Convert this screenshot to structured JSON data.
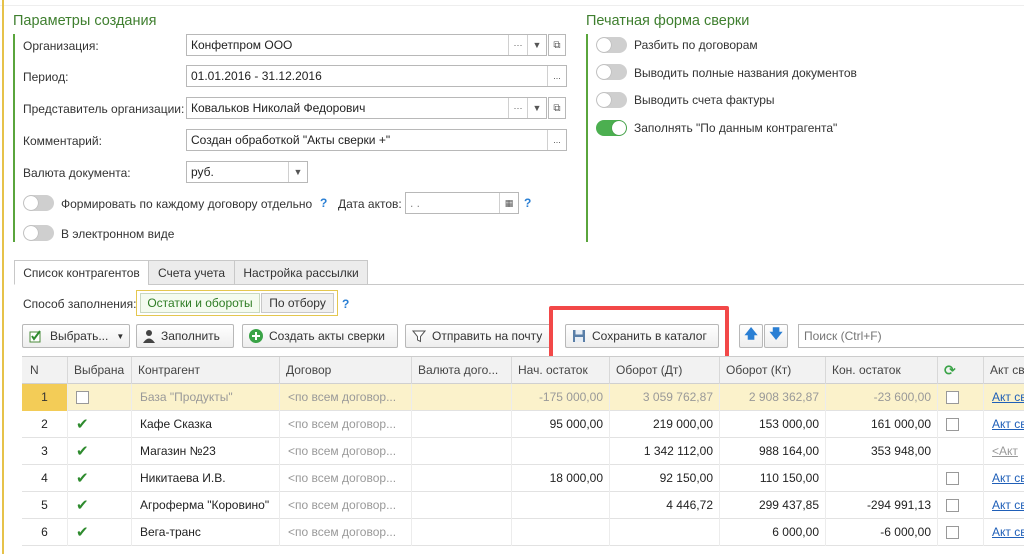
{
  "params": {
    "title": "Параметры создания",
    "org_label": "Организация:",
    "org_value": "Конфетпром ООО",
    "period_label": "Период:",
    "period_value": "01.01.2016 - 31.12.2016",
    "rep_label": "Представитель организации:",
    "rep_value": "Ковальков Николай Федорович",
    "comment_label": "Комментарий:",
    "comment_value": "Создан обработкой \"Акты сверки +\"",
    "currency_label": "Валюта документа:",
    "currency_value": "руб.",
    "per_contract_label": "Формировать по каждому договору отдельно",
    "act_date_label": "Дата актов:",
    "act_date_value": " .  .",
    "electronic_label": "В электронном виде"
  },
  "print": {
    "title": "Печатная форма сверки",
    "opt1": "Разбить по договорам",
    "opt2": "Выводить полные названия документов",
    "opt3": "Выводить счета фактуры",
    "opt4": "Заполнять \"По данным контрагента\""
  },
  "tabs": [
    "Список контрагентов",
    "Счета учета",
    "Настройка рассылки"
  ],
  "fill": {
    "label": "Способ заполнения:",
    "opt_a": "Остатки и обороты",
    "opt_b": "По отбору"
  },
  "toolbar": {
    "select": "Выбрать...",
    "fill": "Заполнить",
    "create": "Создать акты сверки",
    "send": "Отправить на почту",
    "save": "Сохранить в каталог",
    "search_placeholder": "Поиск (Ctrl+F)"
  },
  "grid": {
    "headers": [
      "N",
      "Выбрана",
      "Контрагент",
      "Договор",
      "Валюта дого...",
      "Нач. остаток",
      "Оборот (Дт)",
      "Оборот (Кт)",
      "Кон. остаток",
      "",
      "Акт св"
    ],
    "rows": [
      {
        "n": "1",
        "checked": false,
        "name": "База \"Продукты\"",
        "contract": "<по всем договор...",
        "start": "-175 000,00",
        "dt": "3 059 762,87",
        "kt": "2 908 362,87",
        "end": "-23 600,00",
        "flag": "box",
        "act": "Акт св"
      },
      {
        "n": "2",
        "checked": true,
        "name": "Кафе Сказка",
        "contract": "<по всем договор...",
        "start": "95 000,00",
        "dt": "219 000,00",
        "kt": "153 000,00",
        "end": "161 000,00",
        "flag": "box",
        "act": "Акт св"
      },
      {
        "n": "3",
        "checked": true,
        "name": "Магазин №23",
        "contract": "<по всем договор...",
        "start": "",
        "dt": "1 342 112,00",
        "kt": "988 164,00",
        "end": "353 948,00",
        "flag": "",
        "act": "<Акт"
      },
      {
        "n": "4",
        "checked": true,
        "name": "Никитаева И.В.",
        "contract": "<по всем договор...",
        "start": "18 000,00",
        "dt": "92 150,00",
        "kt": "110 150,00",
        "end": "",
        "flag": "box",
        "act": "Акт св"
      },
      {
        "n": "5",
        "checked": true,
        "name": "Агроферма \"Коровино\"",
        "contract": "<по всем договор...",
        "start": "",
        "dt": "4 446,72",
        "kt": "299 437,85",
        "end": "-294 991,13",
        "flag": "box",
        "act": "Акт св"
      },
      {
        "n": "6",
        "checked": true,
        "name": "Вега-транс",
        "contract": "<по всем договор...",
        "start": "",
        "dt": "",
        "kt": "6 000,00",
        "end": "-6 000,00",
        "flag": "box",
        "act": "Акт св"
      }
    ]
  },
  "colors": {
    "accent": "#5aa53c",
    "highlight": "#f24848",
    "selected_row": "#fbf2cb"
  }
}
